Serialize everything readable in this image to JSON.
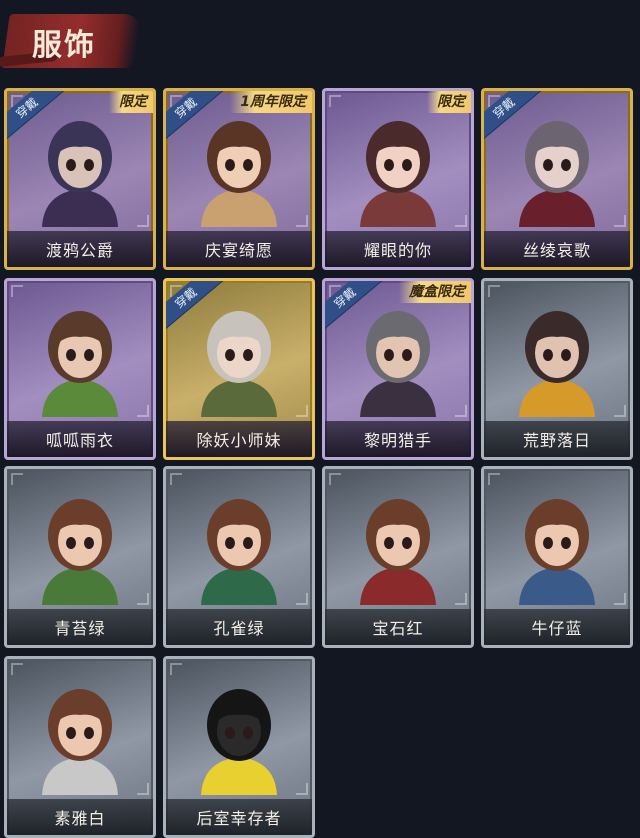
{
  "header": {
    "title": "服饰"
  },
  "cards": [
    {
      "name": "渡鸦公爵",
      "style": "gold",
      "wearing": "穿戴",
      "tag": "限定",
      "hair": "#3a3456",
      "skin": "#d9c2b8",
      "outfit": "#3c2e52"
    },
    {
      "name": "庆宴绮愿",
      "style": "gold",
      "wearing": "穿戴",
      "tag": "1周年限定",
      "hair": "#5a3526",
      "skin": "#f0cdb5",
      "outfit": "#c9a070"
    },
    {
      "name": "耀眼的你",
      "style": "purple",
      "wearing": "",
      "tag": "限定",
      "hair": "#4a2a2a",
      "skin": "#f1d1c3",
      "outfit": "#7a3a3a"
    },
    {
      "name": "丝绫哀歌",
      "style": "gold",
      "wearing": "穿戴",
      "tag": "",
      "hair": "#6c6470",
      "skin": "#e6d0cb",
      "outfit": "#6a1f2c"
    },
    {
      "name": "呱呱雨衣",
      "style": "purple",
      "wearing": "",
      "tag": "",
      "hair": "#5a3a2a",
      "skin": "#e8c8b2",
      "outfit": "#5a8a3a"
    },
    {
      "name": "除妖小师妹",
      "style": "goldplus",
      "wearing": "穿戴",
      "tag": "",
      "hair": "#c8c2bc",
      "skin": "#ecd6c8",
      "outfit": "#5a6a3a"
    },
    {
      "name": "黎明猎手",
      "style": "purple",
      "wearing": "穿戴",
      "tag": "魔盒限定",
      "hair": "#6a6a70",
      "skin": "#e2c4b0",
      "outfit": "#3a3040"
    },
    {
      "name": "荒野落日",
      "style": "gray",
      "wearing": "",
      "tag": "",
      "hair": "#3a2a2a",
      "skin": "#e0c2b0",
      "outfit": "#d69a2a"
    },
    {
      "name": "青苔绿",
      "style": "gray",
      "wearing": "",
      "tag": "",
      "hair": "#6a3e2a",
      "skin": "#ecc8b0",
      "outfit": "#4a7a3a"
    },
    {
      "name": "孔雀绿",
      "style": "gray",
      "wearing": "",
      "tag": "",
      "hair": "#6a3e2a",
      "skin": "#ecc8b0",
      "outfit": "#2e6a4a"
    },
    {
      "name": "宝石红",
      "style": "gray",
      "wearing": "",
      "tag": "",
      "hair": "#6a3e2a",
      "skin": "#ecc8b0",
      "outfit": "#8a2a2a"
    },
    {
      "name": "牛仔蓝",
      "style": "gray",
      "wearing": "",
      "tag": "",
      "hair": "#6a3e2a",
      "skin": "#ecc8b0",
      "outfit": "#3a5a8a"
    },
    {
      "name": "素雅白",
      "style": "gray",
      "wearing": "",
      "tag": "",
      "hair": "#6a3e2a",
      "skin": "#ecc8b0",
      "outfit": "#c8c8c8"
    },
    {
      "name": "后室幸存者",
      "style": "gray",
      "wearing": "",
      "tag": "",
      "hair": "#151515",
      "skin": "#2a2a2a",
      "outfit": "#e8d030"
    }
  ]
}
